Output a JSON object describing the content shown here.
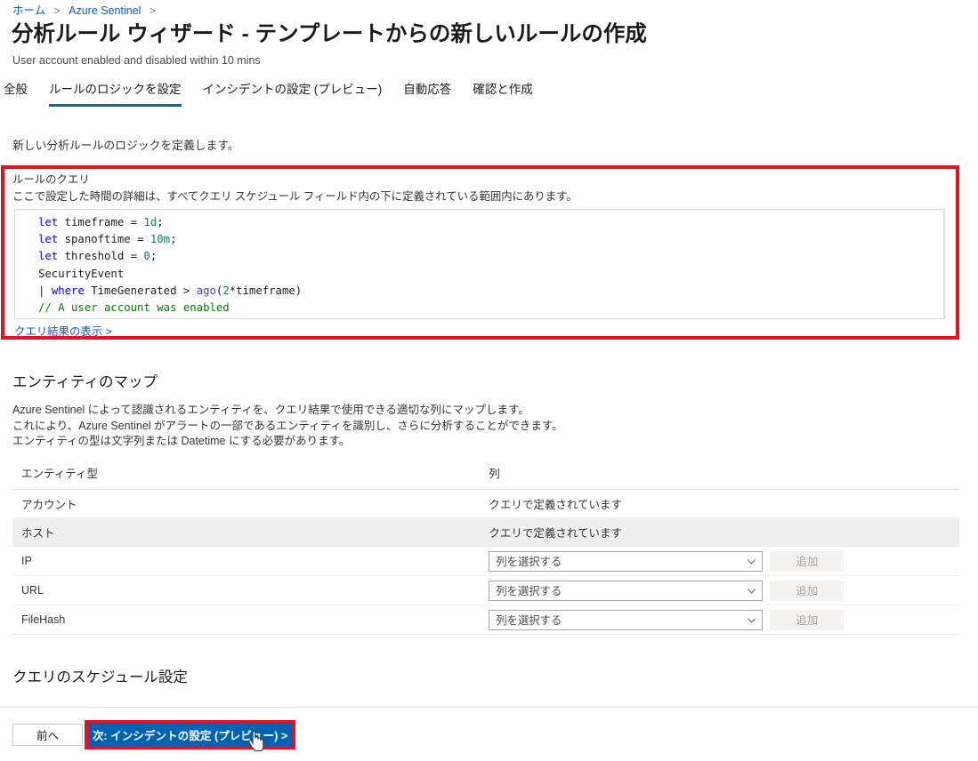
{
  "breadcrumb": {
    "items": [
      {
        "label": "ホーム"
      },
      {
        "label": "Azure Sentinel"
      }
    ],
    "separator": ">"
  },
  "header": {
    "title": "分析ルール ウィザード - テンプレートからの新しいルールの作成",
    "subtitle": "User account enabled and disabled within 10 mins"
  },
  "tabs": [
    {
      "label": "全般",
      "active": false
    },
    {
      "label": "ルールのロジックを設定",
      "active": true
    },
    {
      "label": "インシデントの設定 (プレビュー)",
      "active": false
    },
    {
      "label": "自動応答",
      "active": false
    },
    {
      "label": "確認と作成",
      "active": false
    }
  ],
  "intro": {
    "text": "新しい分析ルールのロジックを定義します。"
  },
  "rule_query": {
    "label": "ルールのクエリ",
    "description": "ここで設定した時間の詳細は、すべてクエリ スケジュール フィールド内の下に定義されている範囲内にあります。",
    "code_lines": [
      {
        "tokens": [
          {
            "t": "let",
            "c": "kw"
          },
          {
            "t": " timeframe ",
            "c": "txt"
          },
          {
            "t": "= ",
            "c": "op"
          },
          {
            "t": "1d",
            "c": "num"
          },
          {
            "t": ";",
            "c": "txt"
          }
        ]
      },
      {
        "tokens": [
          {
            "t": "let",
            "c": "kw"
          },
          {
            "t": " spanoftime ",
            "c": "txt"
          },
          {
            "t": "= ",
            "c": "op"
          },
          {
            "t": "10m",
            "c": "num"
          },
          {
            "t": ";",
            "c": "txt"
          }
        ]
      },
      {
        "tokens": [
          {
            "t": "let",
            "c": "kw"
          },
          {
            "t": " threshold ",
            "c": "txt"
          },
          {
            "t": "= ",
            "c": "op"
          },
          {
            "t": "0",
            "c": "num"
          },
          {
            "t": ";",
            "c": "txt"
          }
        ]
      },
      {
        "tokens": [
          {
            "t": "SecurityEvent",
            "c": "txt"
          }
        ]
      },
      {
        "tokens": [
          {
            "t": "| ",
            "c": "txt"
          },
          {
            "t": "where",
            "c": "kw"
          },
          {
            "t": " TimeGenerated > ",
            "c": "txt"
          },
          {
            "t": "ago",
            "c": "fn"
          },
          {
            "t": "(",
            "c": "txt"
          },
          {
            "t": "2",
            "c": "num"
          },
          {
            "t": "*timeframe)",
            "c": "txt"
          }
        ]
      },
      {
        "tokens": [
          {
            "t": "// A user account was enabled",
            "c": "cmt"
          }
        ]
      }
    ],
    "results_link": "クエリ結果の表示 >"
  },
  "entity_map": {
    "title": "エンティティのマップ",
    "description_lines": [
      "Azure Sentinel によって認識されるエンティティを、クエリ結果で使用できる適切な列にマップします。",
      "これにより、Azure Sentinel がアラートの一部であるエンティティを識別し、さらに分析することができます。",
      "エンティティの型は文字列または Datetime にする必要があります。"
    ],
    "columns": [
      {
        "label": "エンティティ型"
      },
      {
        "label": "列"
      }
    ],
    "rows": [
      {
        "entity_type": "アカウント",
        "kind": "text",
        "value": "クエリで定義されています",
        "shaded": false
      },
      {
        "entity_type": "ホスト",
        "kind": "text",
        "value": "クエリで定義されています",
        "shaded": true
      },
      {
        "entity_type": "IP",
        "kind": "control",
        "dropdown_value": "列を選択する",
        "add_label": "追加",
        "shaded": false
      },
      {
        "entity_type": "URL",
        "kind": "control",
        "dropdown_value": "列を選択する",
        "add_label": "追加",
        "shaded": false
      },
      {
        "entity_type": "FileHash",
        "kind": "control",
        "dropdown_value": "列を選択する",
        "add_label": "追加",
        "shaded": false
      }
    ]
  },
  "schedule": {
    "title": "クエリのスケジュール設定"
  },
  "footer": {
    "prev_label": "前へ",
    "next_label": "次: インシデントの設定 (プレビュー) >"
  },
  "colors": {
    "accent_blue": "#0063b1",
    "link_blue": "#015cda",
    "annotation_red": "#e81123",
    "tab_underline": "#016f8d",
    "shaded_row": "#eeeeee"
  }
}
